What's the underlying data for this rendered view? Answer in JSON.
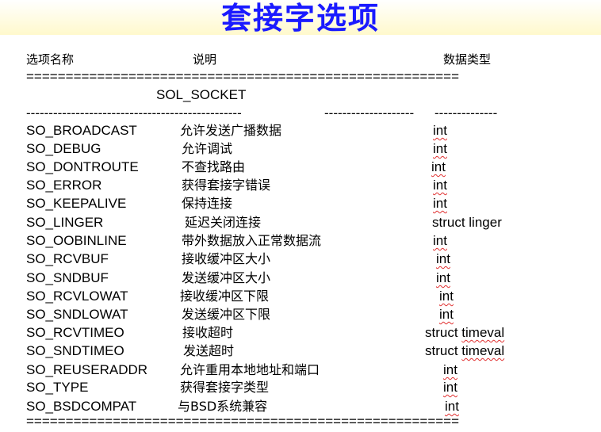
{
  "title": "套接字选项",
  "columns": {
    "name": "选项名称",
    "desc": "说明",
    "type": "数据类型"
  },
  "rule_double": "=======================================================",
  "rule_single_a": "------------------------------------------------",
  "rule_single_b": "--------------------",
  "rule_single_c": "--------------",
  "section": "SOL_SOCKET",
  "rule_double_bottom": "=======================================================",
  "rows": [
    {
      "name": "SO_BROADCAST",
      "desc": "允许发送广播数据",
      "type": "int"
    },
    {
      "name": "SO_DEBUG",
      "desc": "允许调试",
      "type": "int"
    },
    {
      "name": "SO_DONTROUTE",
      "desc": "不查找路由",
      "type": "int"
    },
    {
      "name": "SO_ERROR",
      "desc": "获得套接字错误",
      "type": "int"
    },
    {
      "name": "SO_KEEPALIVE",
      "desc": "保持连接",
      "type": "int"
    },
    {
      "name": "SO_LINGER",
      "desc": "延迟关闭连接",
      "type": "struct linger"
    },
    {
      "name": "SO_OOBINLINE",
      "desc": "带外数据放入正常数据流",
      "type": "int"
    },
    {
      "name": "SO_RCVBUF",
      "desc": "接收缓冲区大小",
      "type": "int"
    },
    {
      "name": "SO_SNDBUF",
      "desc": "发送缓冲区大小",
      "type": "int"
    },
    {
      "name": "SO_RCVLOWAT",
      "desc": "接收缓冲区下限",
      "type": "int"
    },
    {
      "name": "SO_SNDLOWAT",
      "desc": "发送缓冲区下限",
      "type": "int"
    },
    {
      "name": "SO_RCVTIMEO",
      "desc": "接收超时",
      "type": "struct timeval"
    },
    {
      "name": "SO_SNDTIMEO",
      "desc": "发送超时",
      "type": "struct timeval"
    },
    {
      "name": "SO_REUSERADDR",
      "desc": "允许重用本地地址和端口",
      "type": "int"
    },
    {
      "name": "SO_TYPE",
      "desc": "获得套接字类型",
      "type": "int"
    },
    {
      "name": "SO_BSDCOMPAT",
      "desc": "与BSD系统兼容",
      "type": "int"
    }
  ]
}
